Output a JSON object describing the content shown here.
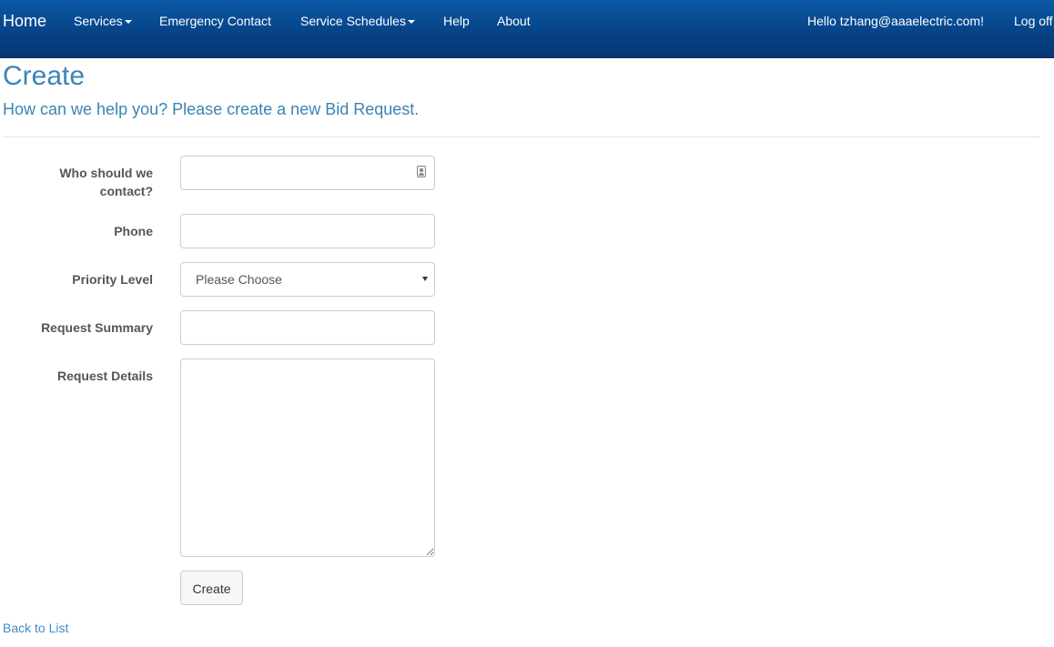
{
  "navbar": {
    "brand": "Home",
    "items": [
      {
        "label": "Services",
        "dropdown": true
      },
      {
        "label": "Emergency Contact",
        "dropdown": false
      },
      {
        "label": "Service Schedules",
        "dropdown": true
      },
      {
        "label": "Help",
        "dropdown": false
      },
      {
        "label": "About",
        "dropdown": false
      }
    ],
    "greeting": "Hello tzhang@aaaelectric.com!",
    "logoff": "Log off"
  },
  "page": {
    "title": "Create",
    "subtitle": "How can we help you? Please create a new Bid Request."
  },
  "form": {
    "contact": {
      "label": "Who should we contact?",
      "value": "",
      "icon": "contact-card-icon"
    },
    "phone": {
      "label": "Phone",
      "value": ""
    },
    "priority": {
      "label": "Priority Level",
      "selected": "Please Choose"
    },
    "summary": {
      "label": "Request Summary",
      "value": ""
    },
    "details": {
      "label": "Request Details",
      "value": ""
    },
    "submit_label": "Create"
  },
  "footer": {
    "back_link": "Back to List"
  },
  "colors": {
    "navbar": "#063e7e",
    "heading": "#3a84b5",
    "link": "#428bca"
  }
}
